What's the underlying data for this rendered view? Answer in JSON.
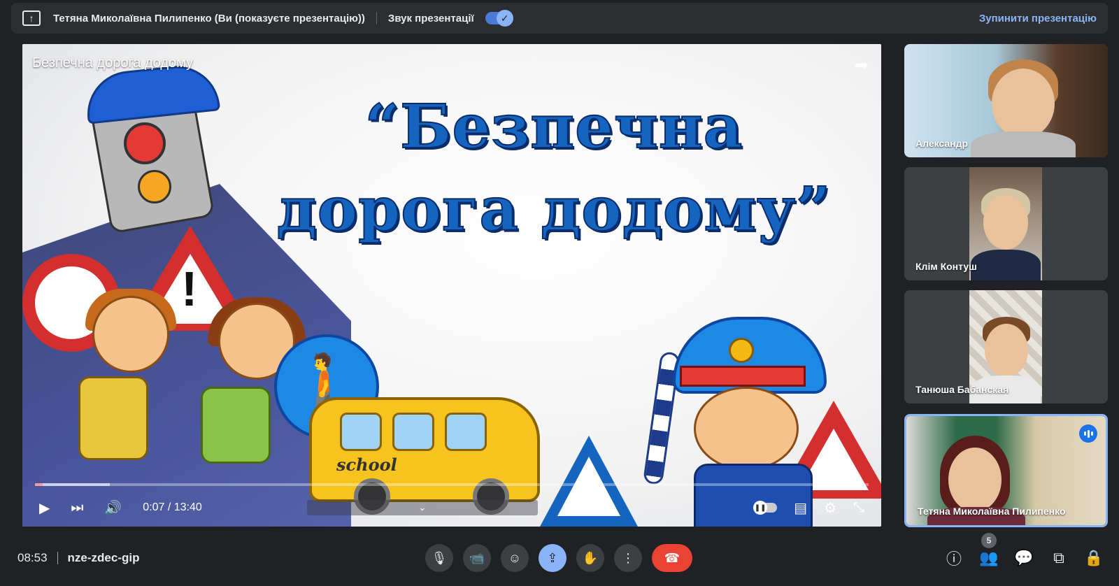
{
  "topbar": {
    "presenter_label": "Тетяна Миколаївна Пилипенко (Ви (показуєте презентацію))",
    "sound_label": "Звук презентації",
    "sound_enabled": true,
    "stop_label": "Зупинити презентацію"
  },
  "video": {
    "title": "Безпечна дорога додому",
    "slide_title_line1": "“Безпечна",
    "slide_title_line2": "дорога додому”",
    "bus_label": "school",
    "time": "0:07 / 13:40",
    "progress_fraction": 0.009
  },
  "participants": [
    {
      "name": "Александр",
      "active": false
    },
    {
      "name": "Клім Контуш",
      "active": false
    },
    {
      "name": "Танюша Бабанская",
      "active": false
    },
    {
      "name": "Тетяна Миколаївна Пилипенко",
      "active": true,
      "speaking": true
    }
  ],
  "bottombar": {
    "clock": "08:53",
    "meeting_code": "nze-zdec-gip",
    "people_count": "5"
  },
  "colors": {
    "accent": "#8ab4f8",
    "end_call": "#ea4335",
    "background": "#202124"
  }
}
